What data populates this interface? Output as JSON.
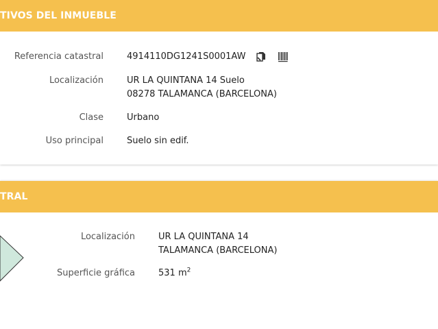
{
  "section1": {
    "header": "TIVOS DEL INMUEBLE",
    "rows": [
      {
        "label": "Referencia catastral",
        "value": "4914110DG1241S0001AW"
      },
      {
        "label": "Localización",
        "value_line1": "UR LA QUINTANA 14 Suelo",
        "value_line2": "08278 TALAMANCA (BARCELONA)"
      },
      {
        "label": "Clase",
        "value": "Urbano"
      },
      {
        "label": "Uso principal",
        "value": "Suelo sin edif."
      }
    ],
    "icons": [
      "copy-icon",
      "barcode-icon"
    ]
  },
  "section2": {
    "header": "TRAL",
    "rows": [
      {
        "label": "Localización",
        "value_line1": "UR LA QUINTANA 14",
        "value_line2": "TALAMANCA (BARCELONA)"
      },
      {
        "label": "Superficie gráfica",
        "value": "531 m",
        "unit_sup": "2"
      }
    ]
  },
  "colors": {
    "header_bg": "#f5c04e",
    "header_text": "#ffffff",
    "parcel_fill": "#cfe8dc",
    "parcel_stroke": "#333333"
  }
}
